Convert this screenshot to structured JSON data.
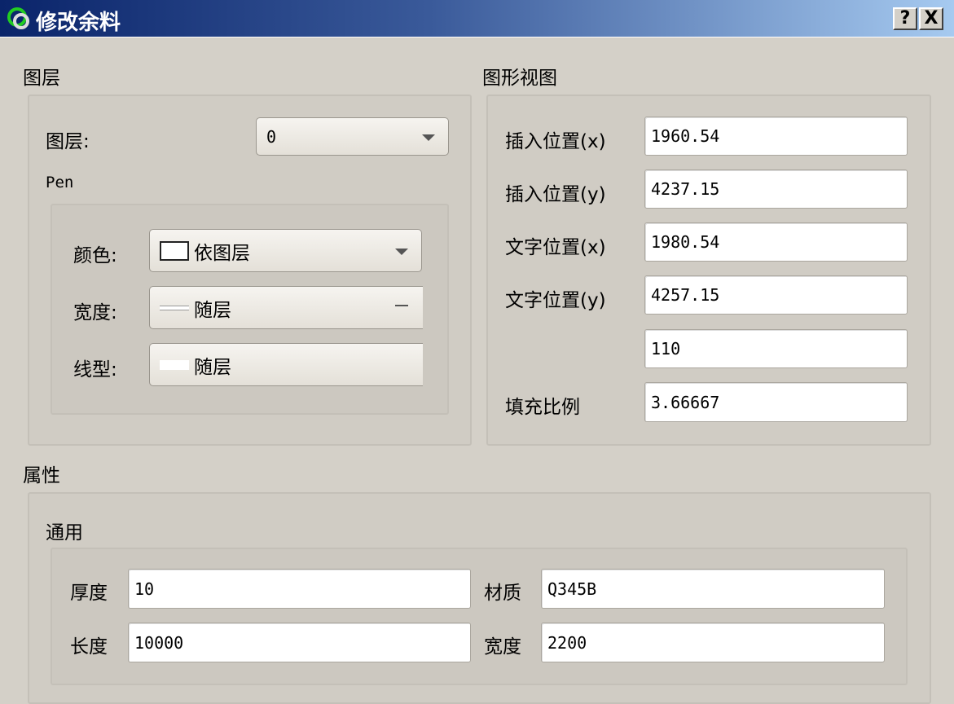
{
  "window": {
    "title": "修改余料",
    "help_label": "?",
    "close_label": "X"
  },
  "layer_group": {
    "heading": "图层",
    "layer_label": "图层:",
    "layer_value": "0",
    "pen_label": "Pen",
    "color_label": "颜色:",
    "color_value": "依图层",
    "width_label": "宽度:",
    "width_value": "随层",
    "linetype_label": "线型:",
    "linetype_value": "随层"
  },
  "view_group": {
    "heading": "图形视图",
    "rows": [
      {
        "label": "插入位置(x)",
        "value": "1960.54"
      },
      {
        "label": "插入位置(y)",
        "value": "4237.15"
      },
      {
        "label": "文字位置(x)",
        "value": "1980.54"
      },
      {
        "label": "文字位置(y)",
        "value": "4257.15"
      },
      {
        "label": "",
        "value": "110"
      },
      {
        "label": "填充比例",
        "value": "3.66667"
      }
    ]
  },
  "props_group": {
    "heading": "属性",
    "general_heading": "通用",
    "thickness_label": "厚度",
    "thickness_value": "10",
    "material_label": "材质",
    "material_value": "Q345B",
    "length_label": "长度",
    "length_value": "10000",
    "width_label": "宽度",
    "width_value": "2200"
  }
}
